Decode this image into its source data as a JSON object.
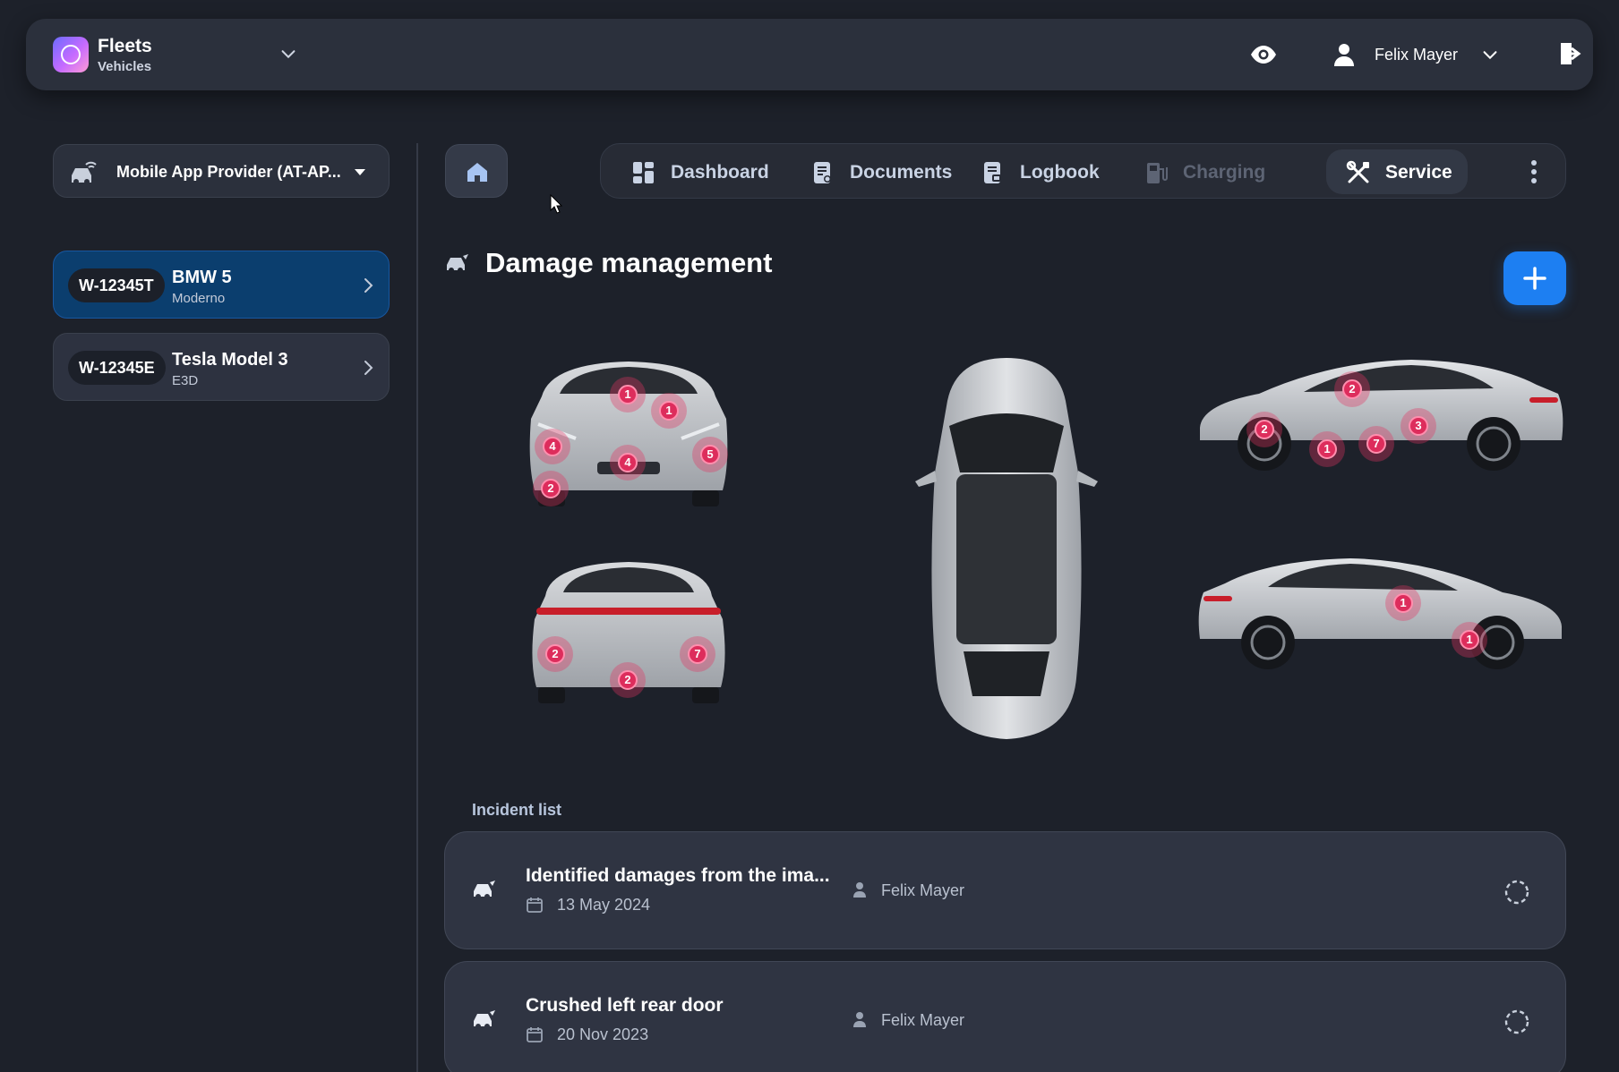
{
  "app": {
    "title": "Fleets",
    "subtitle": "Vehicles"
  },
  "user": {
    "name": "Felix Mayer"
  },
  "sidebar": {
    "provider": "Mobile App Provider (AT-AP...",
    "vehicles": [
      {
        "plate": "W-12345T",
        "name": "BMW 5",
        "sub": "Moderno",
        "active": true
      },
      {
        "plate": "W-12345E",
        "name": "Tesla Model 3",
        "sub": "E3D",
        "active": false
      }
    ]
  },
  "tabs": [
    {
      "label": "Dashboard",
      "icon": "grid-icon",
      "state": "normal"
    },
    {
      "label": "Documents",
      "icon": "document-icon",
      "state": "normal"
    },
    {
      "label": "Logbook",
      "icon": "logbook-icon",
      "state": "normal"
    },
    {
      "label": "Charging",
      "icon": "charging-icon",
      "state": "disabled"
    },
    {
      "label": "Service",
      "icon": "tools-icon",
      "state": "active"
    }
  ],
  "page": {
    "title": "Damage management"
  },
  "colors": {
    "accent": "#1d7ff2",
    "marker": "#dd2d5c",
    "active_card": "#0b3e6e"
  },
  "damage_views": [
    {
      "view": "front",
      "markers": [
        "1",
        "1",
        "4",
        "4",
        "5",
        "2"
      ]
    },
    {
      "view": "rear",
      "markers": [
        "2",
        "7",
        "2"
      ]
    },
    {
      "view": "top",
      "markers": []
    },
    {
      "view": "right-side",
      "markers": [
        "2",
        "2",
        "3",
        "1",
        "7"
      ]
    },
    {
      "view": "left-side",
      "markers": [
        "1",
        "1"
      ]
    }
  ],
  "incidents": {
    "heading": "Incident list",
    "items": [
      {
        "title": "Identified damages from the ima...",
        "date": "13 May 2024",
        "reporter": "Felix Mayer"
      },
      {
        "title": "Crushed left rear door",
        "date": "20 Nov 2023",
        "reporter": "Felix Mayer"
      }
    ]
  }
}
